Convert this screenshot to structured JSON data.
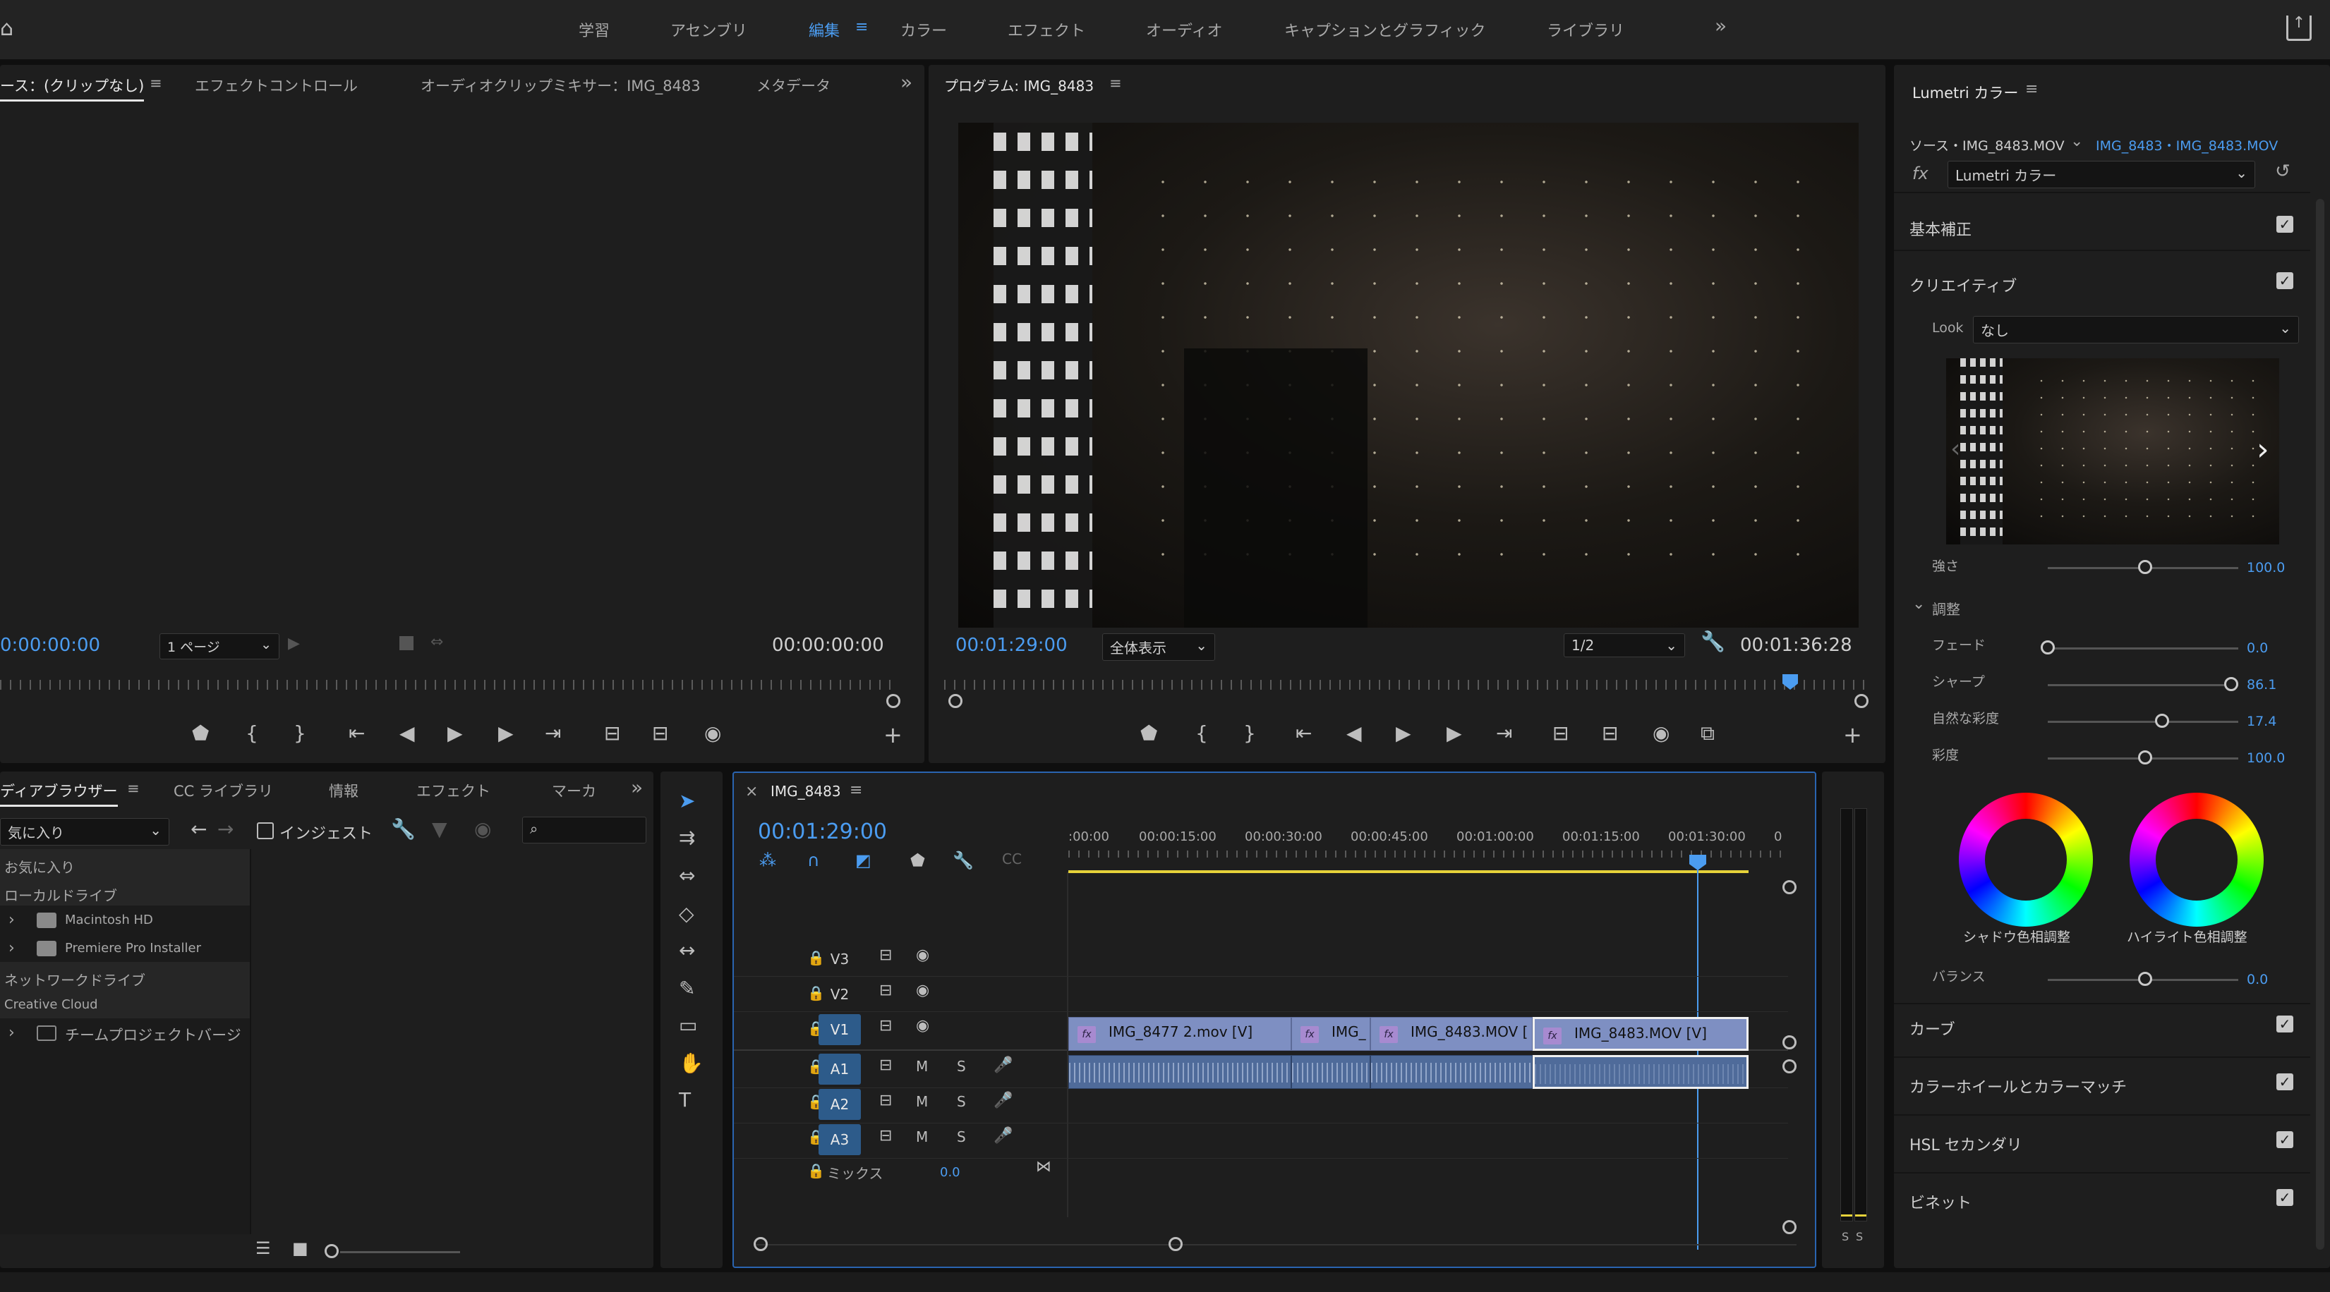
{
  "workspaces": [
    "学習",
    "アセンブリ",
    "編集",
    "カラー",
    "エフェクト",
    "オーディオ",
    "キャプションとグラフィック",
    "ライブラリ"
  ],
  "source_panel": {
    "tabs": [
      "ース：(クリップなし)",
      "エフェクトコントロール",
      "オーディオクリップミキサー：IMG_8483",
      "メタデータ"
    ],
    "timecode_in": "0:00:00:00",
    "page_select": "1 ページ",
    "timecode_out": "00:00:00:00"
  },
  "program_panel": {
    "title": "プログラム: IMG_8483",
    "timecode": "00:01:29:00",
    "fit_select": "全体表示",
    "resolution_select": "1/2",
    "duration": "00:01:36:28"
  },
  "project_panel": {
    "tabs": [
      "ディアブラウザー",
      "CC ライブラリ",
      "情報",
      "エフェクト",
      "マーカ"
    ],
    "favorites_select": "気に入り",
    "ingest_label": "インジェスト",
    "tree": [
      {
        "label": "お気に入り",
        "indent": 0,
        "icon": "",
        "chev": false
      },
      {
        "label": "ローカルドライブ",
        "indent": 0,
        "icon": "",
        "chev": false
      },
      {
        "label": "Macintosh HD",
        "indent": 1,
        "icon": "drive",
        "chev": true
      },
      {
        "label": "Premiere Pro Installer",
        "indent": 1,
        "icon": "drive",
        "chev": true
      },
      {
        "label": "ネットワークドライブ",
        "indent": 0,
        "icon": "",
        "chev": false
      },
      {
        "label": "Creative Cloud",
        "indent": 0,
        "icon": "",
        "chev": false
      },
      {
        "label": "チームプロジェクトバージ",
        "indent": 1,
        "icon": "team",
        "chev": true
      }
    ]
  },
  "timeline": {
    "sequence_name": "IMG_8483",
    "timecode": "00:01:29:00",
    "ruler_labels": [
      ":00:00",
      "00:00:15:00",
      "00:00:30:00",
      "00:00:45:00",
      "00:01:00:00",
      "00:01:15:00",
      "00:01:30:00",
      "0"
    ],
    "video_tracks": [
      "V3",
      "V2",
      "V1"
    ],
    "audio_tracks": [
      "A1",
      "A2",
      "A3"
    ],
    "mix_label": "ミックス",
    "mix_value": "0.0",
    "mute_label": "M",
    "solo_label": "S",
    "video_clips": [
      {
        "name": "IMG_8477 2.mov [V]"
      },
      {
        "name": "IMG_"
      },
      {
        "name": "IMG_8483.MOV ["
      },
      {
        "name": "IMG_8483.MOV [V]"
      }
    ],
    "meter_labels": [
      "S",
      "S"
    ]
  },
  "lumetri": {
    "title": "Lumetri カラー",
    "source_label": "ソース・IMG_8483.MOV",
    "target_label": "IMG_8483・IMG_8483.MOV",
    "effect_select": "Lumetri カラー",
    "sections": {
      "basic": "基本補正",
      "creative": "クリエイティブ",
      "curves": "カーブ",
      "wheels": "カラーホイールとカラーマッチ",
      "hsl": "HSL セカンダリ",
      "vignette": "ビネット"
    },
    "look_label": "Look",
    "look_value": "なし",
    "intensity_label": "強さ",
    "intensity_value": "100.0",
    "intensity_level": 0.5,
    "adjust_label": "調整",
    "sliders": [
      {
        "label": "フェード",
        "value": "0.0",
        "level": 0.0
      },
      {
        "label": "シャープ",
        "value": "86.1",
        "level": 0.93
      },
      {
        "label": "自然な彩度",
        "value": "17.4",
        "level": 0.59
      },
      {
        "label": "彩度",
        "value": "100.0",
        "level": 0.5
      }
    ],
    "shadow_wheel_label": "シャドウ色相調整",
    "highlight_wheel_label": "ハイライト色相調整",
    "balance_label": "バランス",
    "balance_value": "0.0",
    "balance_level": 0.5
  }
}
